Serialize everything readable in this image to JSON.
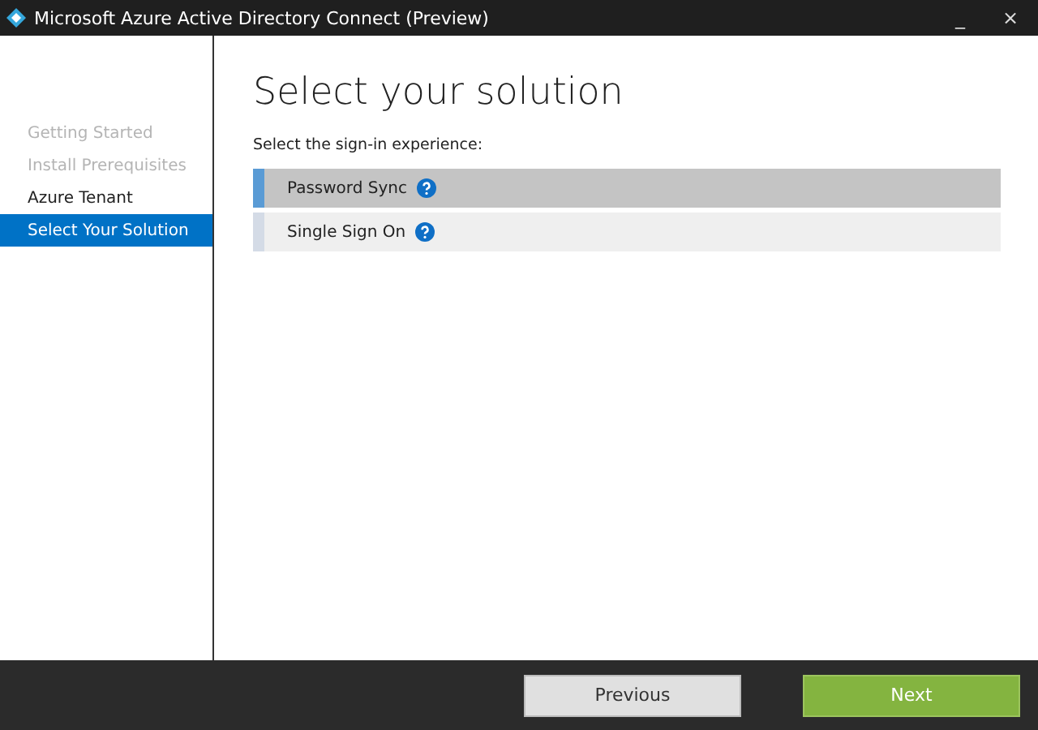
{
  "window": {
    "title": "Microsoft Azure Active Directory Connect (Preview)",
    "minimize": "_",
    "close": "×"
  },
  "sidebar": {
    "items": [
      {
        "label": "Getting Started",
        "disabled": true,
        "selected": false
      },
      {
        "label": "Install Prerequisites",
        "disabled": true,
        "selected": false
      },
      {
        "label": "Azure Tenant",
        "disabled": false,
        "selected": false
      },
      {
        "label": "Select Your Solution",
        "disabled": false,
        "selected": true
      }
    ]
  },
  "content": {
    "heading": "Select your solution",
    "prompt": "Select the sign-in experience:",
    "options": [
      {
        "label": "Password Sync",
        "selected": true
      },
      {
        "label": "Single Sign On",
        "selected": false
      }
    ]
  },
  "footer": {
    "buttons": [
      {
        "label": "Previous",
        "kind": "secondary"
      },
      {
        "label": "Next",
        "kind": "primary"
      }
    ]
  }
}
